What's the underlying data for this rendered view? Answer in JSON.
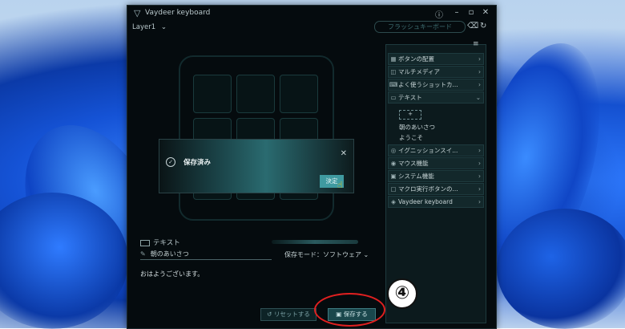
{
  "window": {
    "title": "Vaydeer keyboard",
    "logo_icon": "vaydeer-logo-icon",
    "help_icon": "help-icon"
  },
  "layer": {
    "label": "Layer1",
    "chevron": "⌄"
  },
  "toolbar": {
    "flash_key_label": "フラッシュキーボード",
    "erase_icon": "eraser-icon",
    "refresh_icon": "refresh-icon"
  },
  "toast": {
    "title": "保存済み",
    "button_label": "決定"
  },
  "categories": [
    {
      "label": "ボタンの配置",
      "icon": "▦",
      "chevron": "›"
    },
    {
      "label": "マルチメディア",
      "icon": "◫",
      "chevron": "›"
    },
    {
      "label": "よく使うショットカ...",
      "icon": "⌨",
      "chevron": "›"
    },
    {
      "label": "テキスト",
      "icon": "▭",
      "chevron": "⌄"
    },
    {
      "label": "イグニッションスイ...",
      "icon": "◎",
      "chevron": "›"
    },
    {
      "label": "マウス機能",
      "icon": "◉",
      "chevron": "›"
    },
    {
      "label": "システム機能",
      "icon": "▣",
      "chevron": "›"
    },
    {
      "label": "マクロ実行ボタンの...",
      "icon": "▢",
      "chevron": "›"
    },
    {
      "label": "Vaydeer keyboard",
      "icon": "◈",
      "chevron": "›"
    }
  ],
  "text_items": {
    "add": "+",
    "item1": "朝のあいさつ",
    "item2": "ようこそ"
  },
  "editor": {
    "section_label": "テキスト",
    "name_value": "朝のあいさつ",
    "save_mode": "保存モード：ソフトウェア ⌄",
    "content": "おはようございます。",
    "reset_label": "リセットする",
    "save_label": "保存する"
  },
  "annotation": {
    "step": "④"
  },
  "colors": {
    "accent": "#3f9aa0",
    "highlight": "#e02020"
  }
}
